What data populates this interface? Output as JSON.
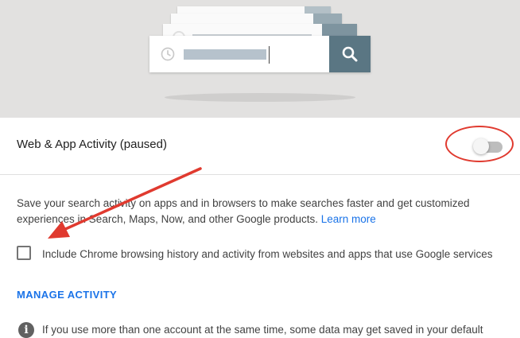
{
  "activity": {
    "title": "Web & App Activity (paused)",
    "enabled": false
  },
  "description": {
    "text": "Save your search activity on apps and in browsers to make searches faster and get customized experiences in Search, Maps, Now, and other Google products.",
    "learn_more": "Learn more"
  },
  "chrome_history": {
    "label": "Include Chrome browsing history and activity from websites and apps that use Google services",
    "checked": false
  },
  "manage_activity": "MANAGE ACTIVITY",
  "info": {
    "text": "If you use more than one account at the same time, some data may get saved in your default"
  },
  "icons": {
    "search": "search-icon",
    "clock": "clock-icon",
    "info": "info-icon"
  },
  "colors": {
    "accent": "#1a73e8",
    "search_button": "#5a7683",
    "annotation_red": "#e03a2f"
  }
}
